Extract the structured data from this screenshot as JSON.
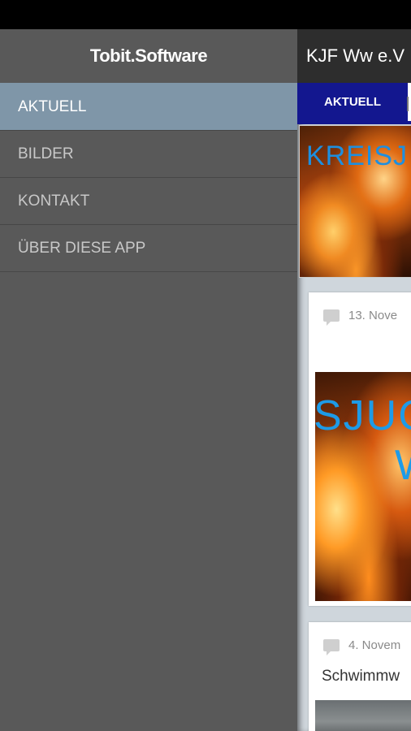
{
  "drawer": {
    "brand": "Tobit.Software",
    "items": [
      {
        "label": "AKTUELL",
        "active": true
      },
      {
        "label": "BILDER",
        "active": false
      },
      {
        "label": "KONTAKT",
        "active": false
      },
      {
        "label": "ÜBER DIESE APP",
        "active": false
      }
    ]
  },
  "app": {
    "title": "KJF Ww e.V",
    "tabs": [
      {
        "label": "AKTUELL"
      }
    ],
    "hero_text": "KREISJ",
    "posts": [
      {
        "date": "13. Nove",
        "image_text_1": "SJUG",
        "image_text_2": "W"
      },
      {
        "date": "4. Novem",
        "title": "Schwimmw"
      }
    ]
  },
  "colors": {
    "drawer_bg": "#595959",
    "drawer_active": "#7f96a8",
    "tab_accent": "#13178f",
    "statusbar": "#000000"
  },
  "icons": [
    "comment-icon"
  ]
}
